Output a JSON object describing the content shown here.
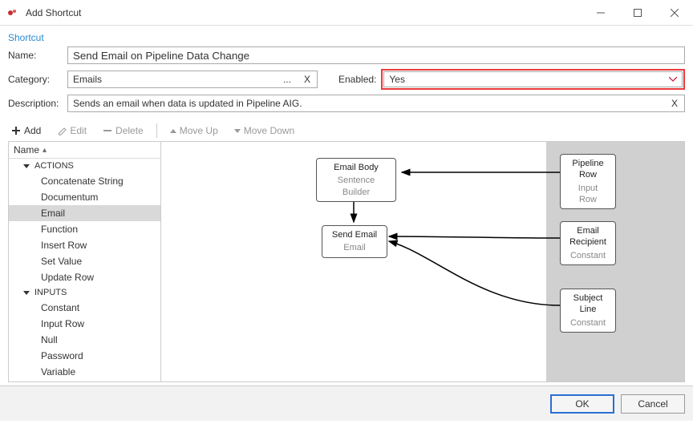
{
  "window": {
    "title": "Add Shortcut"
  },
  "section": "Shortcut",
  "labels": {
    "name": "Name:",
    "category": "Category:",
    "enabled": "Enabled:",
    "description": "Description:"
  },
  "form": {
    "name": "Send Email on Pipeline Data Change",
    "category": "Emails",
    "enabled": "Yes",
    "description": "Sends an email when data is updated in Pipeline AIG."
  },
  "toolbar": {
    "add": "Add",
    "edit": "Edit",
    "delete": "Delete",
    "moveUp": "Move Up",
    "moveDown": "Move Down"
  },
  "tree": {
    "header": "Name",
    "groups": [
      {
        "label": "ACTIONS",
        "items": [
          "Concatenate String",
          "Documentum",
          "Email",
          "Function",
          "Insert Row",
          "Set Value",
          "Update Row"
        ],
        "selected": "Email"
      },
      {
        "label": "INPUTS",
        "items": [
          "Constant",
          "Input Row",
          "Null",
          "Password",
          "Variable"
        ]
      }
    ]
  },
  "nodes": {
    "emailBody": {
      "title": "Email Body",
      "sub": "Sentence Builder"
    },
    "sendEmail": {
      "title": "Send Email",
      "sub": "Email"
    },
    "pipelineRow": {
      "title": "Pipeline Row",
      "sub": "Input Row"
    },
    "emailRecipient": {
      "title": "Email Recipient",
      "sub": "Constant"
    },
    "subjectLine": {
      "title": "Subject Line",
      "sub": "Constant"
    }
  },
  "buttons": {
    "ok": "OK",
    "cancel": "Cancel",
    "dots": "...",
    "x": "X"
  }
}
